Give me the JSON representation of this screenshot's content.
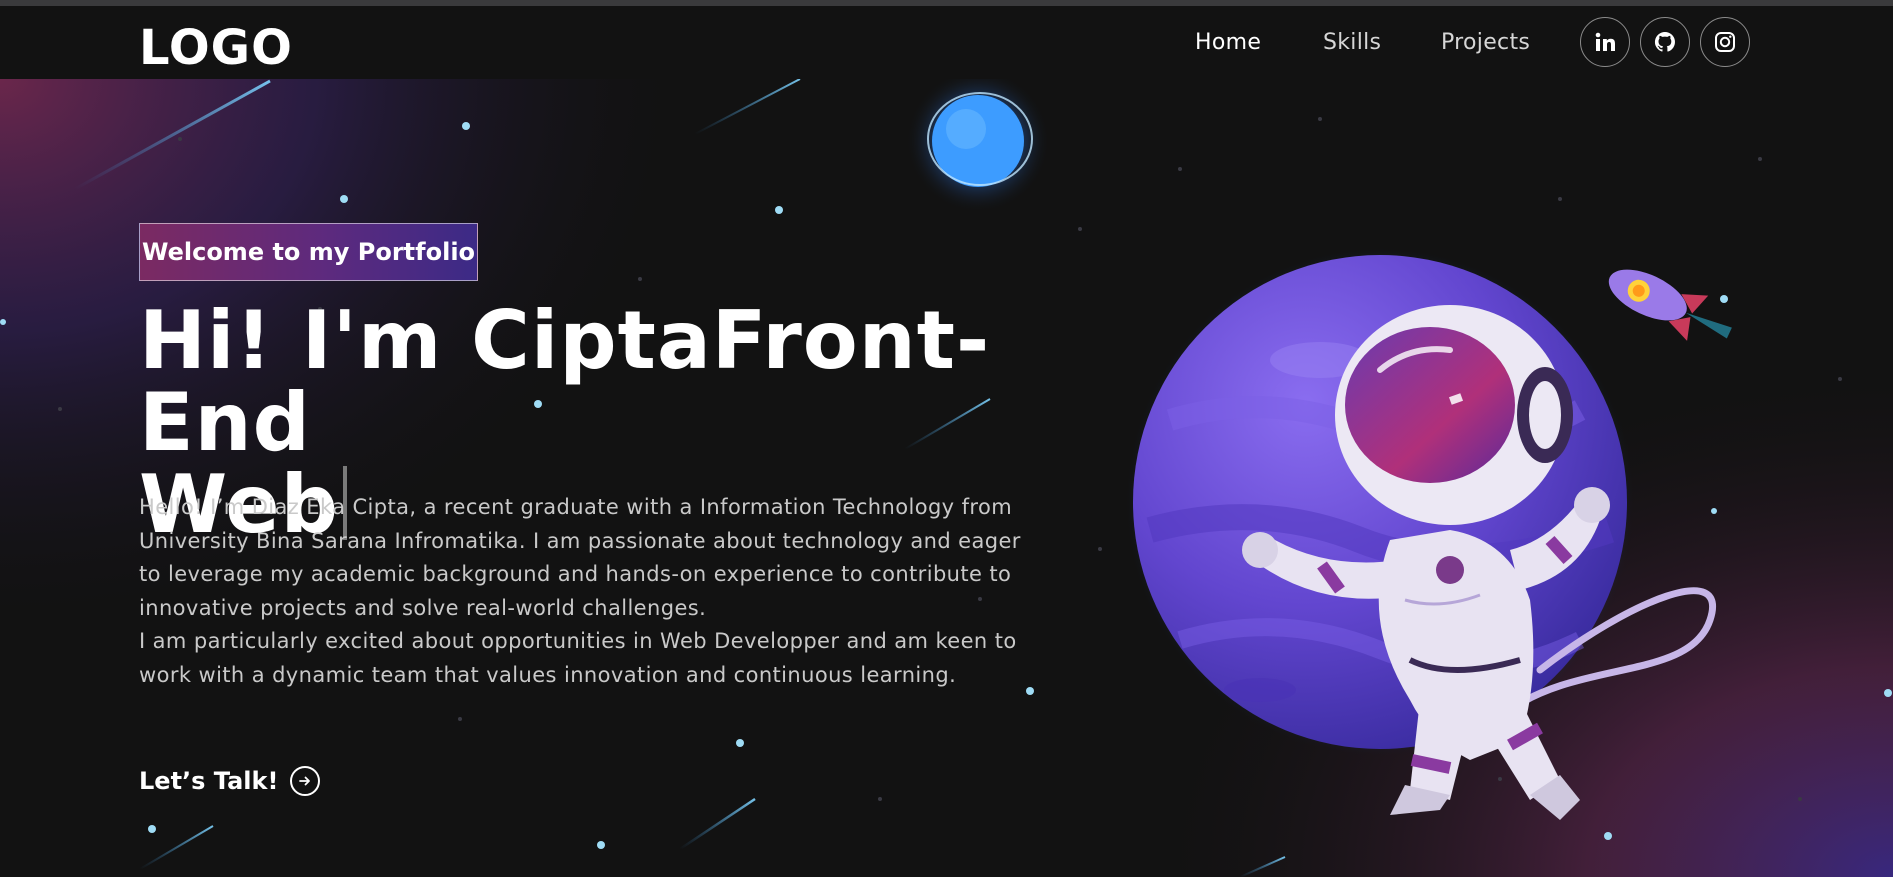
{
  "nav": {
    "logo": "LOGO",
    "links": [
      "Home",
      "Skills",
      "Projects"
    ],
    "social_icons": [
      "linkedin-icon",
      "github-icon",
      "instagram-icon"
    ]
  },
  "hero": {
    "tagline": "Welcome to my Portfolio",
    "headline_line1": "Hi! I'm CiptaFront-End",
    "headline_line2": "Web",
    "bio_paragraphs": [
      "Hello! I’m Diaz Eka Cipta, a recent graduate with a Information Technology from University Bina Sarana Infromatika. I am passionate about technology and eager to leverage my academic background and hands-on experience to contribute to innovative projects and solve real-world challenges.",
      "I am particularly excited about opportunities in Web Developper and am keen to work with a dynamic team that values innovation and continuous learning."
    ],
    "cta_label": "Let’s Talk!"
  },
  "theme": {
    "background": "#121212",
    "tagline_gradient_start": "#7b2a62",
    "tagline_gradient_end": "#3c2a86",
    "planet": "#6a4bd8",
    "star": "#9fdcf5"
  }
}
